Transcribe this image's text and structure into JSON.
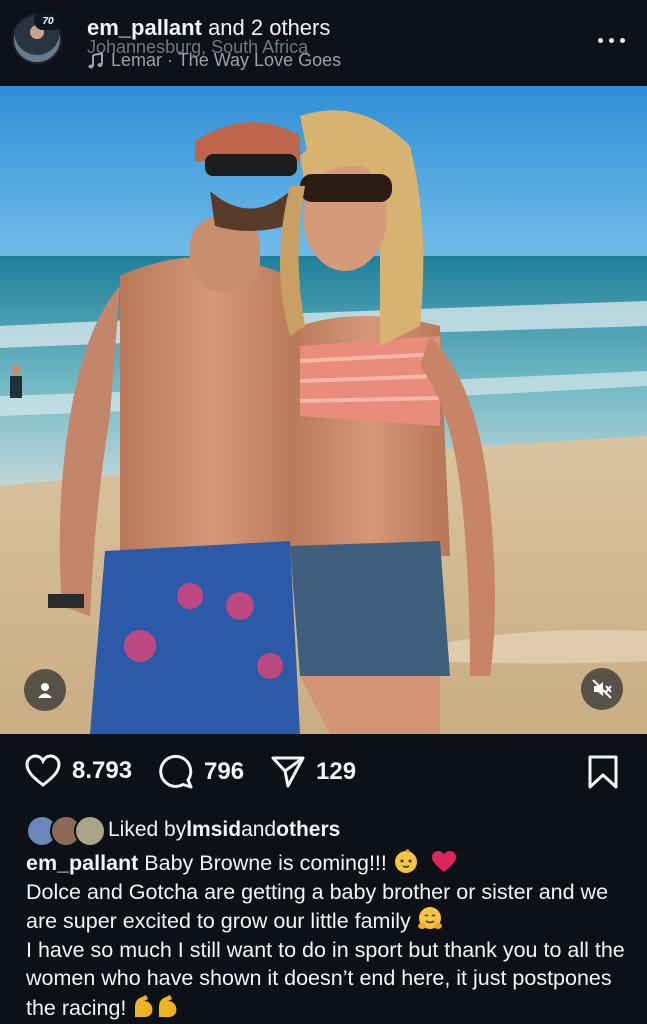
{
  "header": {
    "username": "em_pallant",
    "and_others": "and 2 others",
    "location": "Johannesburg, South Africa",
    "music": "Lemar · The Way Love Goes",
    "avatar_badge": "70"
  },
  "actions": {
    "likes": "8.793",
    "comments": "796",
    "shares": "129"
  },
  "liked_by": {
    "prefix": "Liked by ",
    "user": "lmsid",
    "middle": " and ",
    "others": "others"
  },
  "caption": {
    "username": "em_pallant",
    "line1": " Baby Browne is coming!!! ",
    "line2": "Dolce and Gotcha are getting a baby brother or sister and we are super excited to grow our little family ",
    "line3": "I have so much I still want to do in sport but thank you to all the women who have shown it doesn’t end here, it just postpones the racing! "
  },
  "colors": {
    "background": "#0d1117",
    "text": "#f2f4f5",
    "muted": "#6f7680",
    "heart": "#e0245e"
  },
  "icons": [
    "more-icon",
    "music-note-icon",
    "heart-icon",
    "comment-icon",
    "share-icon",
    "bookmark-icon",
    "person-icon",
    "mute-icon"
  ]
}
